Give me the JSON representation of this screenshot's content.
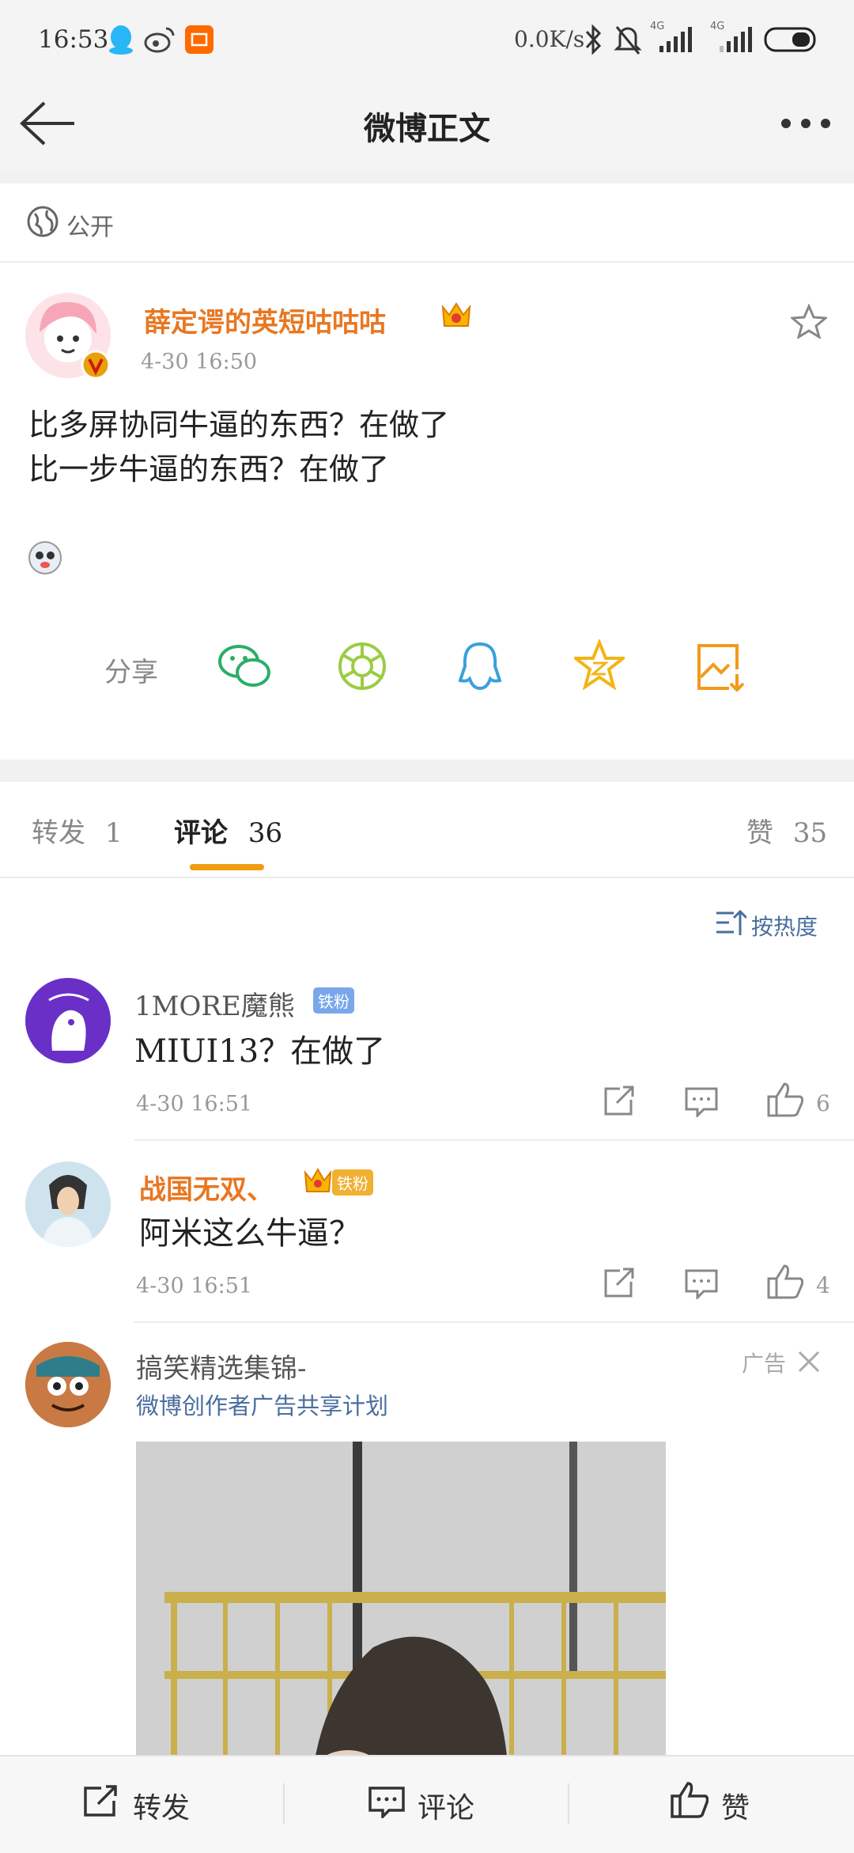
{
  "status_bar": {
    "time": "16:53",
    "speed": "0.0K/s",
    "net1": "4G",
    "net2": "4G"
  },
  "app_bar": {
    "title": "微博正文"
  },
  "post": {
    "visibility": "公开",
    "author": "薛定谔的英短咕咕咕",
    "time": "4-30 16:50",
    "lines": [
      "比多屏协同牛逼的东西？在做了",
      "比一步牛逼的东西？在做了"
    ]
  },
  "share": {
    "label": "分享"
  },
  "tabs": {
    "repost_label": "转发",
    "repost_count": "1",
    "comment_label": "评论",
    "comment_count": "36",
    "like_label": "赞",
    "like_count": "35"
  },
  "sort": {
    "label": "按热度"
  },
  "comments": [
    {
      "name": "1MORE魔熊",
      "badge": "铁粉",
      "text": "MIUI13？在做了",
      "time": "4-30 16:51",
      "likes": "6"
    },
    {
      "name": "战国无双、",
      "badge": "铁粉",
      "text": "阿米这么牛逼？",
      "time": "4-30 16:51",
      "likes": "4"
    }
  ],
  "ad": {
    "name": "搞笑精选集锦-",
    "label": "广告",
    "subtitle": "微博创作者广告共享计划"
  },
  "bottom_bar": {
    "repost": "转发",
    "comment": "评论",
    "like": "赞"
  },
  "colors": {
    "accent": "#e87722",
    "link": "#4a6e9e",
    "tab_underline": "#f39c12"
  }
}
